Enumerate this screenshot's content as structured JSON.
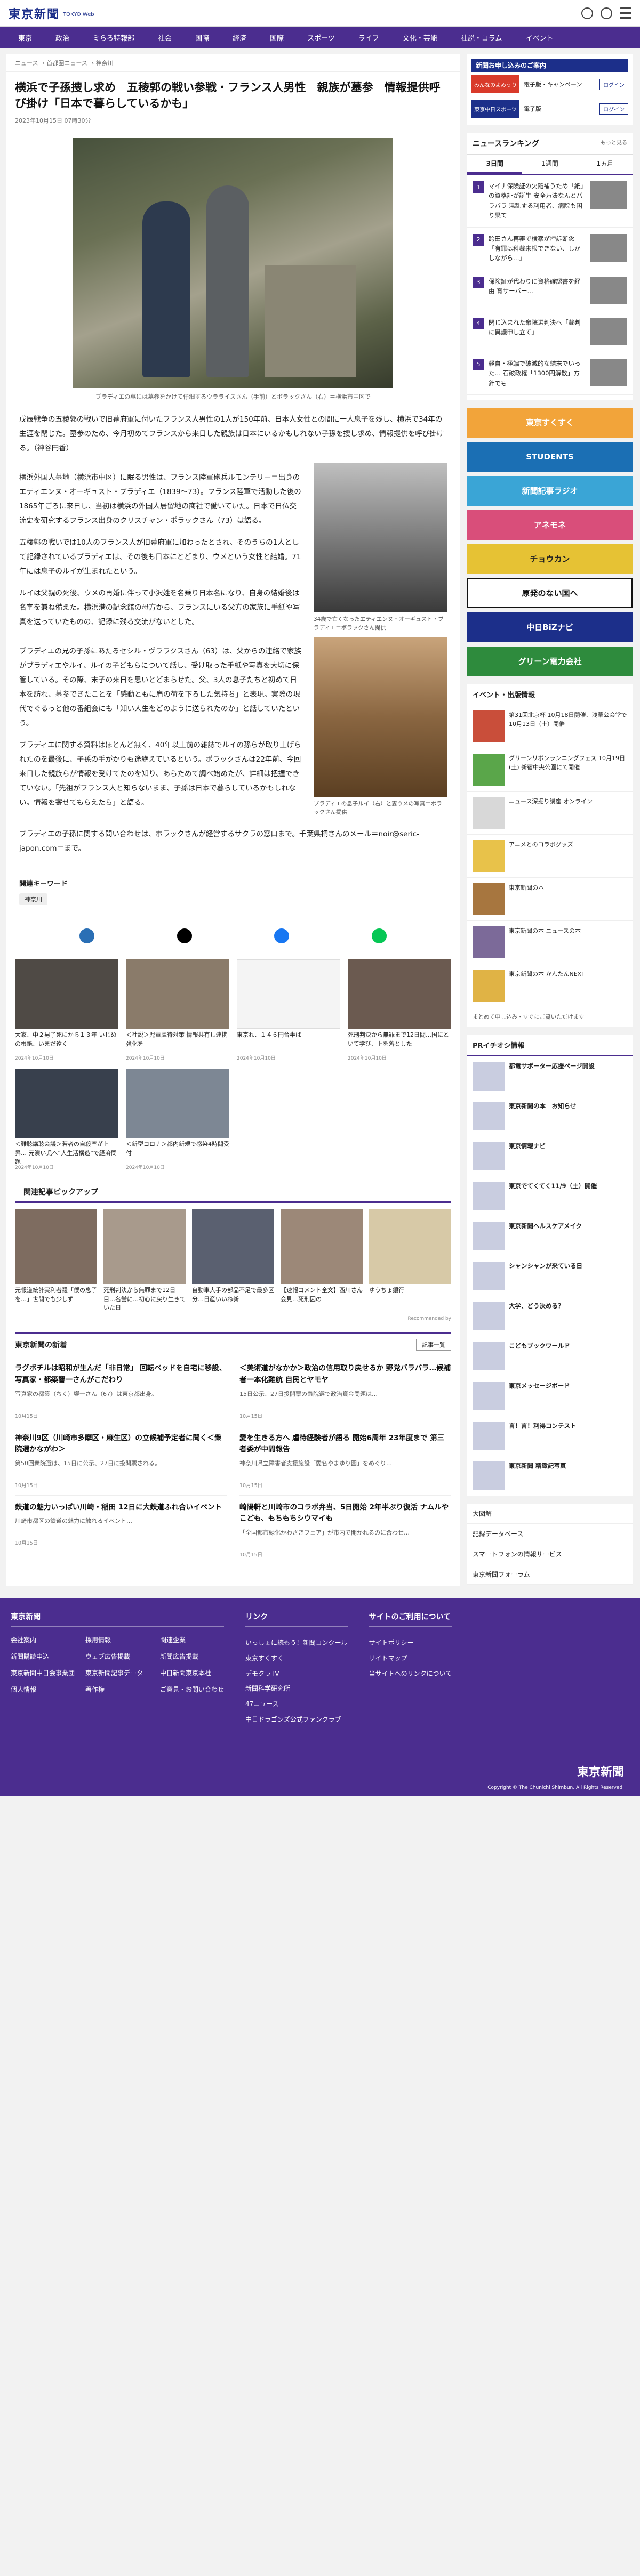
{
  "header": {
    "logo": "東京新聞",
    "logo_sub": "TOKYO Web"
  },
  "nav": [
    "東京",
    "政治",
    "ミらろ特報部",
    "社会",
    "国際",
    "経済",
    "国際",
    "スポーツ",
    "ライフ",
    "文化・芸能",
    "社説・コラム",
    "イベント"
  ],
  "breadcrumbs": [
    "ニュース",
    "首都圏ニュース",
    "神奈川"
  ],
  "article": {
    "headline": "横浜で子孫捜し求め　五稜郭の戦い参戦・フランス人男性　親族が墓参　情報提供呼び掛け「日本で暮らしているかも」",
    "date": "2023年10月15日 07時30分",
    "photo_caption": "ブラディエの墓には墓参をかけて仔細するウラライスさん（手前）とボラックさん（右）＝横浜市中区で",
    "paragraphs": [
      "戊辰戦争の五稜郭の戦いで旧幕府軍に付いたフランス人男性の1人が150年前、日本人女性との間に一人息子を残し、横浜で34年の生涯を閉じた。墓参のため、今月初めてフランスから来日した親族は日本にいるかもしれない子孫を捜し求め、情報提供を呼び掛ける。（神谷円香）",
      "横浜外国人墓地（横浜市中区）に眠る男性は、フランス陸軍砲兵ルモンテリー＝出身のエティエンヌ・オーギュスト・ブラディエ（1839〜73）。フランス陸軍で活動した後の1865年ごろに来日し、当初は横浜の外国人居留地の商社で働いていた。日本で日仏交流史を研究するフランス出身のクリスチャン・ポラックさん（73）は語る。",
      "五稜郭の戦いでは10人のフランス人が旧幕府軍に加わったとされ、そのうちの1人として記録されているブラディエは、その後も日本にとどまり、ウメという女性と結婚。71年には息子のルイが生まれたという。",
      "ルイは父親の死後、ウメの再婚に伴って小沢姓を名乗り日本名になり、自身の結婚後は名字を兼ね備えた。横浜港の記念館の母方から、フランスにいる父方の家族に手紙や写真を送っていたものの、記録に残る交流がないとした。",
      "ブラディエの兄の子孫にあたるセシル・ヴララクスさん（63）は、父からの連絡で家族がブラディエやルイ、ルイの子どもらについて話し、受け取った手紙や写真を大切に保管している。その際、末子の来日を思いとどまらせた。父、3人の息子たちと初めて日本を訪れ、墓参できたことを「感動ともに肩の荷を下ろした気持ち」と表現。実際の現代でぐるっと他の番組会にも「知い人生をどのように送られたのか」と話していたという。",
      "ブラディエに関する資料はほとんど無く、40年以上前の雑誌でルイの孫らが取り上げられたのを最後に、子孫の手がかりも途絶えているという。ポラックさんは22年前、今回来日した親族らが情報を受けてたのを知り、あらためて調べ始めたが、詳細は把握できていない。「先祖がフランス人と知らないまま、子孫は日本で暮らしているかもしれない。情報を寄せてもらえたら」と語る。",
      "ブラディエの子孫に関する問い合わせは、ポラックさんが経営するサクラの窓口まで。千葉県桐さんのメール＝noir@seric-japon.com＝まで。"
    ],
    "fig2_caption": "34歳で亡くなったエティエンヌ・オーギュスト・ブラディエ＝ポラックさん提供",
    "fig3_caption": "ブラディエの息子ルイ（右）と妻ウメの写真＝ポラックさん提供"
  },
  "keywords": {
    "title": "関連キーワード",
    "tags": [
      "神奈川"
    ]
  },
  "related_cards": [
    {
      "title": "大家、中２男子死にから１３年 いじめの根絶、いまだ遠く",
      "date": "2024年10月10日"
    },
    {
      "title": "＜社説＞児童虐待対策 情報共有し連携強化を",
      "date": "2024年10月10日"
    },
    {
      "title": "東京れ、１４６円台半ば",
      "date": "2024年10月10日"
    },
    {
      "title": "死刑判決から無罪まで12日間…国にといて学び、上を落とした",
      "date": "2024年10月10日"
    },
    {
      "title": "＜難聴講聴会議＞若者の自殺率が上昇… 元演い児へ“人生活構造”で経済問題",
      "date": "2024年10月10日"
    },
    {
      "title": "＜新型コロナ＞都内新規で感染4時間受付",
      "date": "2024年10月10日"
    }
  ],
  "pickup": {
    "title": "関連記事ピックアップ",
    "items": [
      "元報道統計実利者殺「僕の息子を…」世間でも少しず",
      "死刑判決から無罪まで12日目…名誉に…初心に戻り生きていた日",
      "自動車大手の部品不足で最多区分…日産いいね新",
      "【速報コメント全文】西川さん会見…死刑囚の",
      "ゆうちょ銀行"
    ],
    "attribution": "Recommended by"
  },
  "latest": {
    "heading": "東京新聞の新着",
    "more": "記事一覧",
    "items": [
      {
        "title": "ラグボチルは昭和が生んだ「非日常」 回転ベッドを自宅に移設、写真家・都築響一さんがこだわり",
        "lead": "写真家の都築（ちく）響一さん（67）は東京都出身。",
        "date": "10月15日"
      },
      {
        "title": "＜美術道がなかか＞政治の信用取り戻せるか 野党バラバラ…候補者一本化難航 自民とヤモヤ",
        "lead": "15日公示、27日投開票の衆院選で政治資金問題は…",
        "date": "10月15日"
      },
      {
        "title": "神奈川9区（川崎市多摩区・麻生区）の立候補予定者に聞く＜衆院選かながわ＞",
        "lead": "第50回衆院選は、15日に公示、27日に投開票される。",
        "date": "10月15日"
      },
      {
        "title": "愛を生きる方へ 虐待経験者が語る 開始6周年 23年度まで 第三者委が中間報告",
        "lead": "神奈川県立障害者支援施設「愛名やまゆり園」をめぐり…",
        "date": "10月15日"
      },
      {
        "title": "鉄道の魅力いっぱい川崎・稲田 12日に大鉄道ふれ合いイベント",
        "lead": "川崎市都区の鉄道の魅力に触れるイベント…",
        "date": "10月15日"
      },
      {
        "title": "崎陽軒と川崎市のコラボ弁当、5日開始 2年半ぶり復活 ナムルやこども、もちもちシウマイも",
        "lead": "「全国都市緑化かわさきフェア」が市内で開かれるのに合わせ…",
        "date": "10月15日"
      }
    ]
  },
  "sidebar": {
    "ad_head": "新聞お申し込みのご案内",
    "ads": [
      {
        "logo": "みんなのよみうり",
        "label": "電子版・キャンペーン",
        "button": "ログイン"
      },
      {
        "logo": "東京中日スポーツ",
        "label": "電子版",
        "button": "ログイン"
      }
    ],
    "ranking": {
      "title": "ニュースランキング",
      "more": "もっと見る",
      "tabs": [
        "3日間",
        "1週間",
        "1ヵ月"
      ],
      "items": [
        "マイナ保険証の欠陥補うため「紙」の資格証が誕生 安全万法なんとバラバラ 混乱する利用者、病院も困り果て",
        "跨田さん再審で検察が控訴断念「有罪は科裁来根できない、しかしながら…」",
        "保険証が代わりに資格確認書を経由 育サーバー…",
        "閉じ込まれた衆院選判決へ「裁判に異議申し立て」",
        "軽自・極端で破滅的な結末でいった… 石破政権「1300円解散」方針でも"
      ]
    },
    "banners": [
      "東京すくすく",
      "STUDENTS",
      "新聞記事ラジオ",
      "アネモネ",
      "チョウカン",
      "原発のない国へ",
      "中日BiZナビ",
      "グリーン電力会社"
    ],
    "events": {
      "title": "イベント・出版情報",
      "items": [
        "第31回北京杯 10月18日開催、浅草公会堂で10月13日（土）開催",
        "グリーンリボンランニングフェス 10月19日 (土) 新宿中央公園にて開催",
        "ニュース深掘り講座 オンライン",
        "アニメとのコラボグッズ",
        "東京新聞の本",
        "東京新聞の本 ニュースの本",
        "東京新聞の本 かんたんNEXT"
      ],
      "footer": "まとめて申し込み・すぐにご覧いただけます"
    },
    "pr": {
      "title": "PRイチオシ情報",
      "items": [
        "都電サポーター応援ページ開設",
        "東京新聞の本　お知らせ",
        "東京情報ナビ",
        "東京でてくてく11/9（土）開催",
        "東京新聞ヘルスケアメイク",
        "シャンシャンが来ている日",
        "大学、どう決める？",
        "こどもブックワールド",
        "東京メッセージボード",
        "言！言！利得コンテスト",
        "東京新聞 精緻記写真"
      ]
    },
    "links": [
      "大図解",
      "記録データベース",
      "スマートフォンの情報サービス",
      "東京新聞フォーラム"
    ]
  },
  "footer": {
    "col1_title": "東京新聞",
    "col1": [
      "会社案内",
      "採用情報",
      "関連企業",
      "新聞購読申込",
      "ウェブ広告掲載",
      "新聞広告掲載",
      "東京新聞中日会事業団",
      "東京新聞記事データ",
      "中日新聞東京本社",
      "個人情報",
      "著作権",
      "ご意見・お問い合わせ"
    ],
    "col2_title": "リンク",
    "col2": [
      "いっしょに読もう！新聞コンクール",
      "東京すくすく",
      "デモクラTV",
      "新聞科学研究所",
      "47ニュース",
      "中日ドラゴンズ公式ファンクラブ"
    ],
    "col3_title": "サイトのご利用について",
    "col3": [
      "サイトポリシー",
      "サイトマップ",
      "当サイトへのリンクについて"
    ],
    "logo": "東京新聞",
    "copyright": "Copyright © The Chunichi Shimbun, All Rights Reserved."
  }
}
